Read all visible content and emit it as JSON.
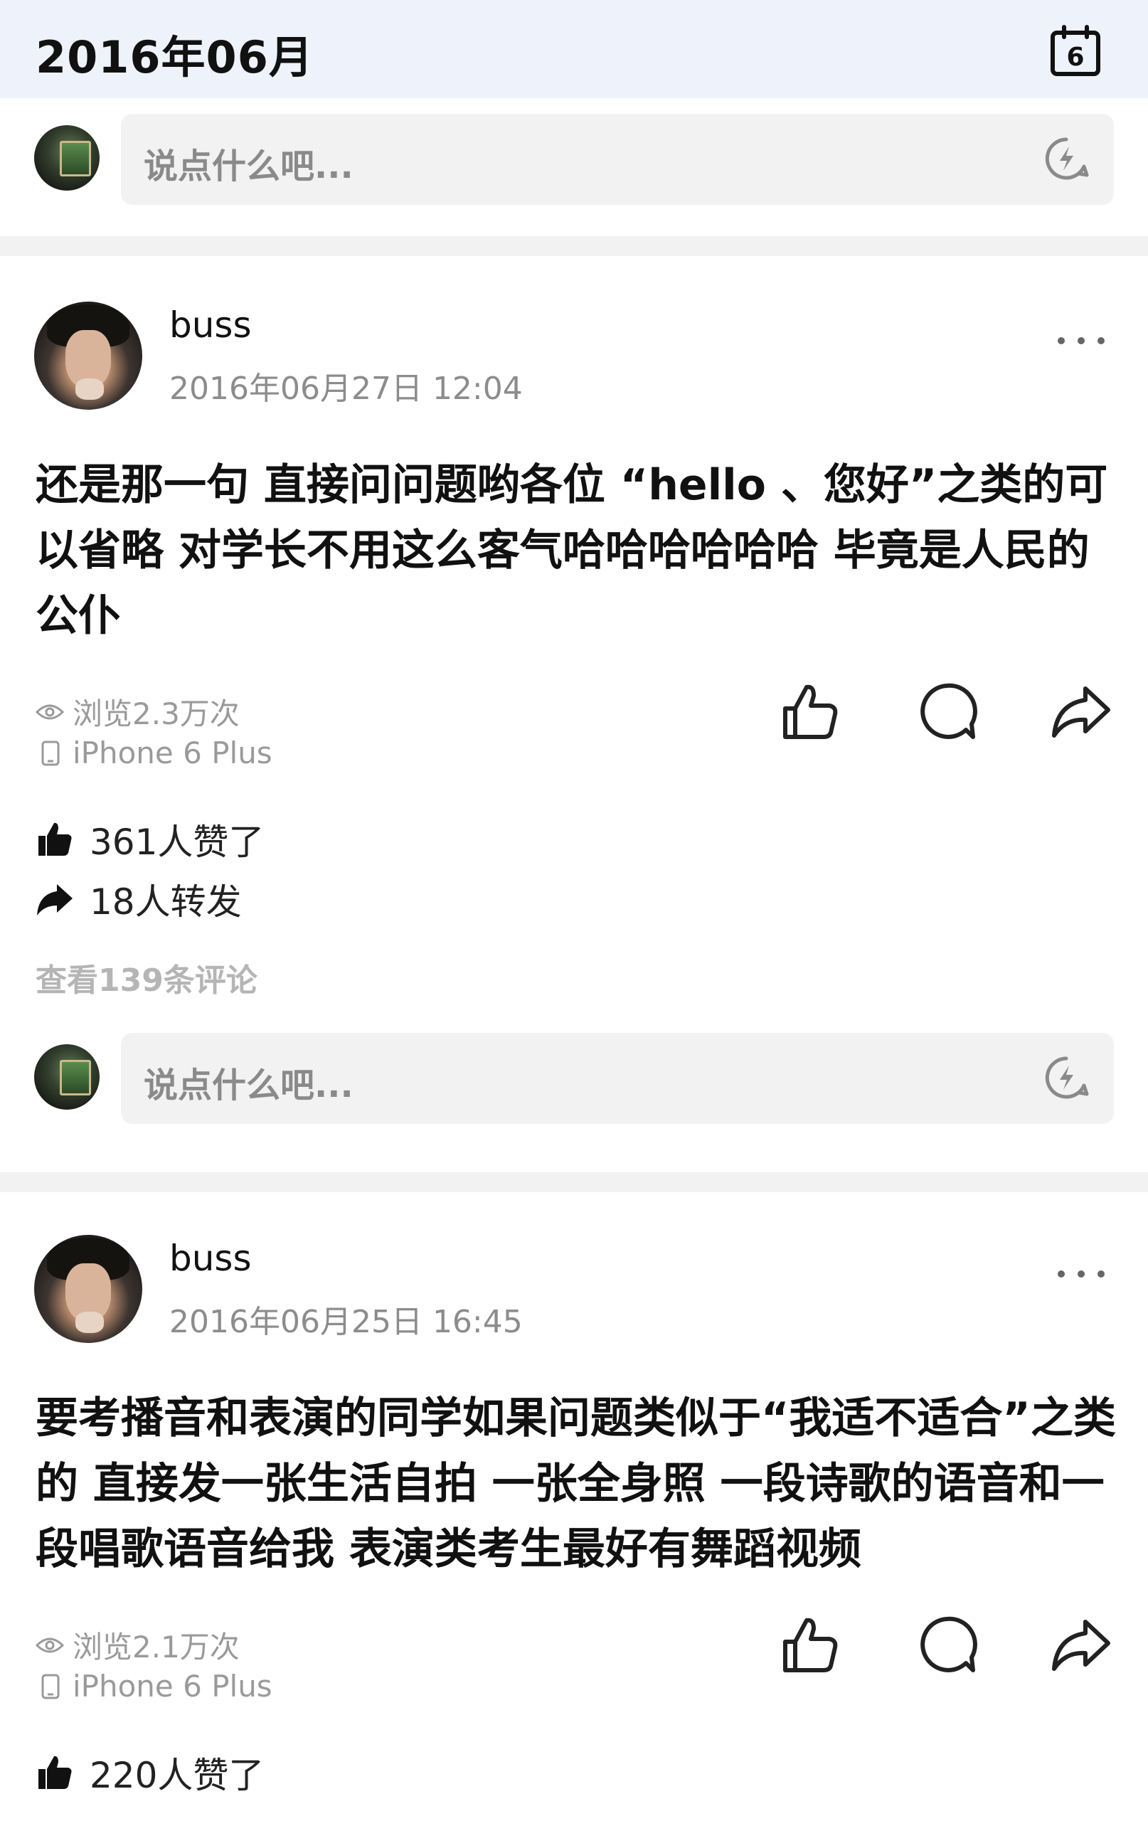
{
  "header": {
    "month_title": "2016年06月",
    "calendar_day": "6"
  },
  "comment_box": {
    "placeholder": "说点什么吧..."
  },
  "posts": [
    {
      "username": "buss",
      "timestamp": "2016年06月27日 12:04",
      "content": "还是那一句 直接问问题哟各位 “hello 、您好”之类的可以省略 对学长不用这么客气哈哈哈哈哈哈 毕竟是人民的公仆",
      "views": "浏览2.3万次",
      "device": "iPhone 6 Plus",
      "likes": "361人赞了",
      "reposts": "18人转发",
      "view_comments": "查看139条评论"
    },
    {
      "username": "buss",
      "timestamp": "2016年06月25日 16:45",
      "content": "要考播音和表演的同学如果问题类似于“我适不适合”之类的 直接发一张生活自拍 一张全身照 一段诗歌的语音和一段唱歌语音给我 表演类考生最好有舞蹈视频",
      "views": "浏览2.1万次",
      "device": "iPhone 6 Plus",
      "likes": "220人赞了"
    }
  ],
  "colors": {
    "header_bg": "#eef2fb",
    "divider": "#f2f2f2",
    "muted_text": "#8c8c8c"
  }
}
